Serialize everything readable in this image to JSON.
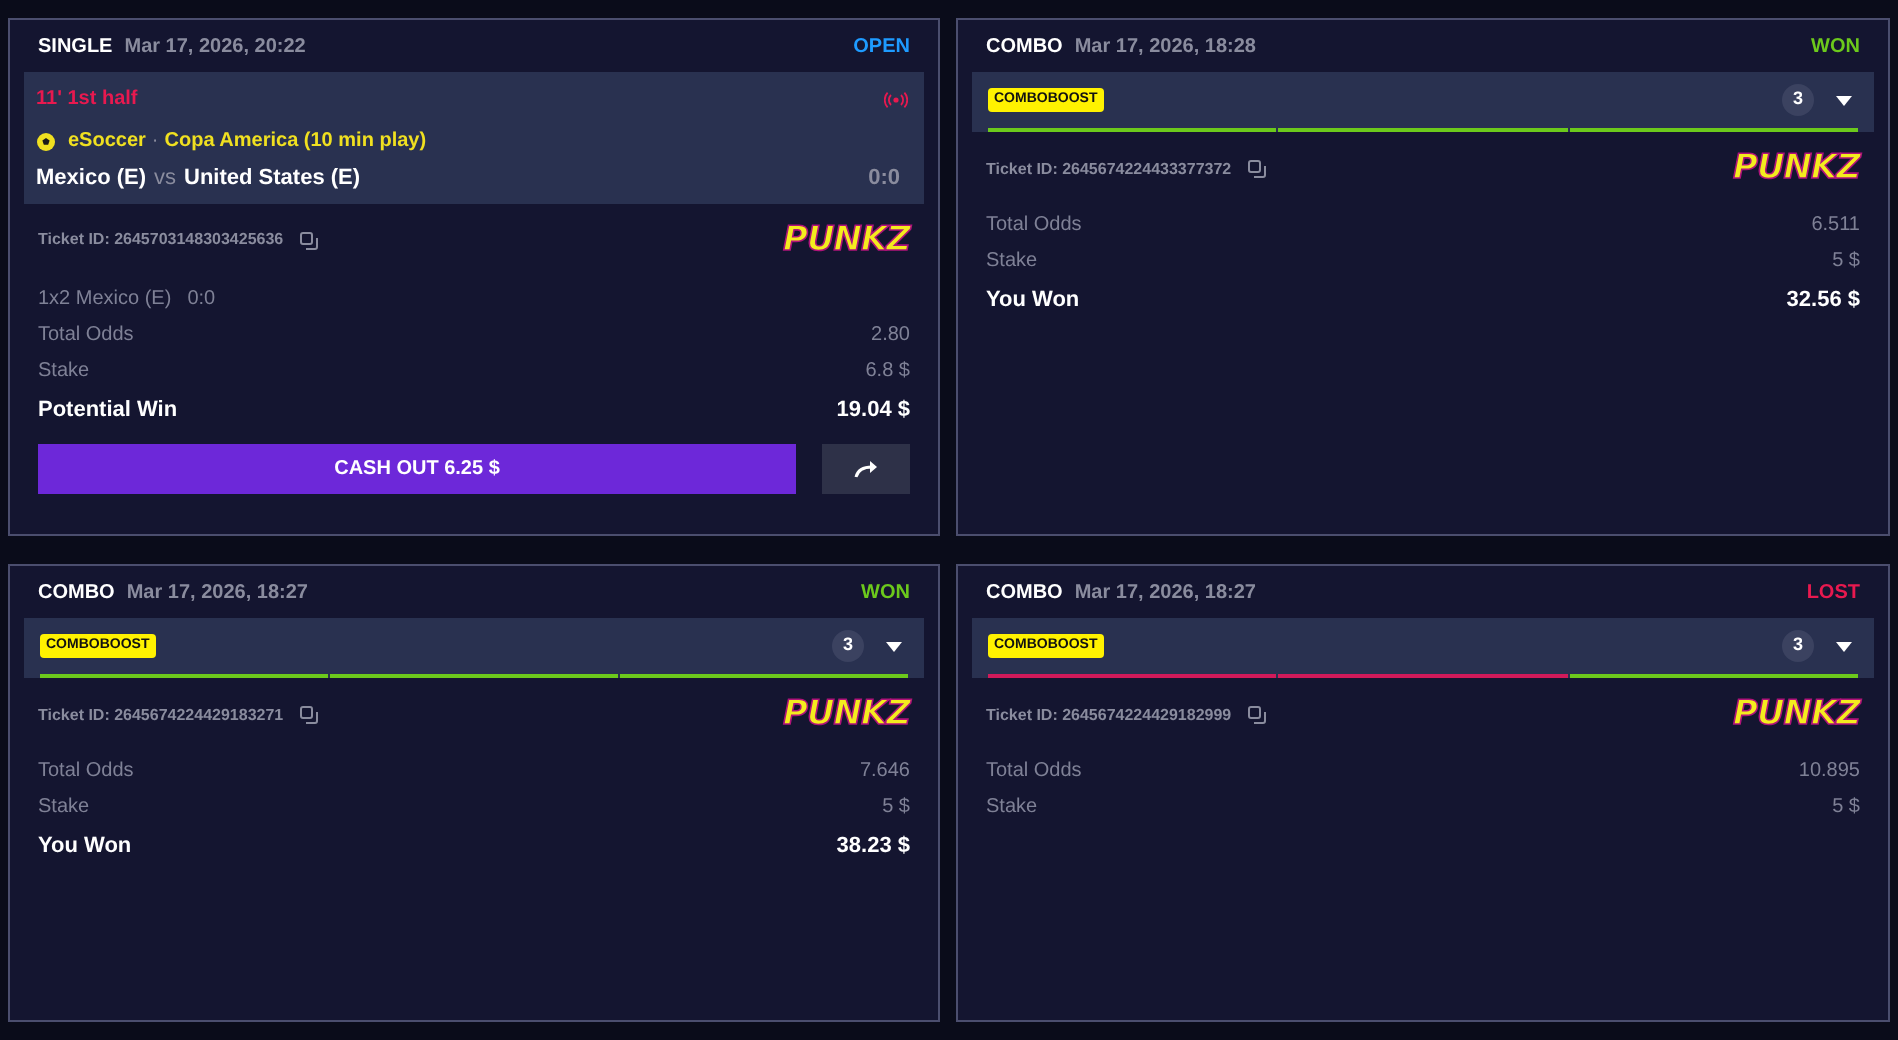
{
  "tickets": [
    {
      "type": "SINGLE",
      "date": "Mar 17, 2026, 20:22",
      "status": {
        "text": "OPEN",
        "color": "#1e9bff"
      },
      "event": {
        "live_time": "11' 1st half",
        "sport": "eSoccer",
        "separator": "·",
        "league": "Copa America (10 min play)",
        "home": "Mexico (E)",
        "vs": "vs",
        "away": "United States (E)",
        "score": "0:0"
      },
      "ticket_id": "Ticket ID: 2645703148303425636",
      "logo": "PUNKZ",
      "selection": {
        "market": "1x2 Mexico (E)",
        "score": "0:0"
      },
      "rows": [
        {
          "kind": "detail",
          "label": "Total Odds",
          "value": "2.80"
        },
        {
          "kind": "detail",
          "label": "Stake",
          "value": "6.8 $"
        },
        {
          "kind": "result",
          "label": "Potential Win",
          "value": "19.04 $"
        }
      ],
      "cash_out": "CASH OUT 6.25 $"
    },
    {
      "type": "COMBO",
      "date": "Mar 17, 2026, 18:28",
      "status": {
        "text": "WON",
        "color": "#6cc91c"
      },
      "boost": {
        "badge": "COMBOBOOST",
        "count": "3",
        "legs": [
          {
            "color": "#6cc91c"
          },
          {
            "color": "#6cc91c"
          },
          {
            "color": "#6cc91c"
          }
        ]
      },
      "ticket_id": "Ticket ID: 2645674224433377372",
      "logo": "PUNKZ",
      "rows": [
        {
          "kind": "detail",
          "label": "Total Odds",
          "value": "6.511"
        },
        {
          "kind": "detail",
          "label": "Stake",
          "value": "5 $"
        },
        {
          "kind": "result",
          "label": "You Won",
          "value": "32.56 $"
        }
      ]
    },
    {
      "type": "COMBO",
      "date": "Mar 17, 2026, 18:27",
      "status": {
        "text": "WON",
        "color": "#6cc91c"
      },
      "boost": {
        "badge": "COMBOBOOST",
        "count": "3",
        "legs": [
          {
            "color": "#6cc91c"
          },
          {
            "color": "#6cc91c"
          },
          {
            "color": "#6cc91c"
          }
        ]
      },
      "ticket_id": "Ticket ID: 2645674224429183271",
      "logo": "PUNKZ",
      "rows": [
        {
          "kind": "detail",
          "label": "Total Odds",
          "value": "7.646"
        },
        {
          "kind": "detail",
          "label": "Stake",
          "value": "5 $"
        },
        {
          "kind": "result",
          "label": "You Won",
          "value": "38.23 $"
        }
      ]
    },
    {
      "type": "COMBO",
      "date": "Mar 17, 2026, 18:27",
      "status": {
        "text": "LOST",
        "color": "#e8194f"
      },
      "boost": {
        "badge": "COMBOBOOST",
        "count": "3",
        "legs": [
          {
            "color": "#d11a5a"
          },
          {
            "color": "#d11a5a"
          },
          {
            "color": "#6cc91c"
          }
        ]
      },
      "ticket_id": "Ticket ID: 2645674224429182999",
      "logo": "PUNKZ",
      "rows": [
        {
          "kind": "detail",
          "label": "Total Odds",
          "value": "10.895"
        },
        {
          "kind": "detail",
          "label": "Stake",
          "value": "5 $"
        }
      ]
    }
  ]
}
